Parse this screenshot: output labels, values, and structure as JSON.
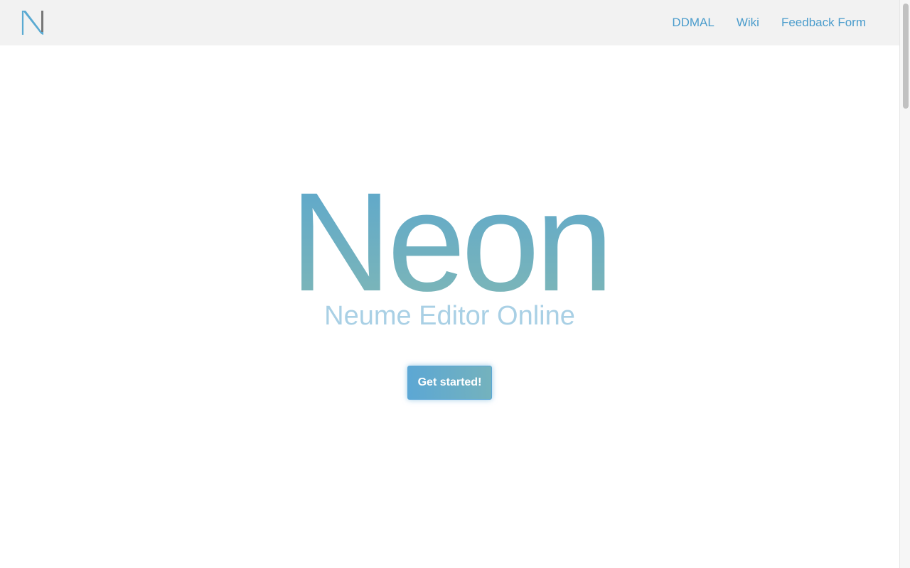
{
  "nav": {
    "logo_icon": "neon-n-logo-icon",
    "links": [
      {
        "label": "DDMAL"
      },
      {
        "label": "Wiki"
      },
      {
        "label": "Feedback Form"
      }
    ]
  },
  "hero": {
    "title": "Neon",
    "subtitle": "Neume Editor Online",
    "cta_label": "Get started!"
  },
  "colors": {
    "navbar_bg": "#f2f2f2",
    "link": "#4a9ccc",
    "title_gradient_start": "#5ca7cd",
    "title_gradient_end": "#7fb7b6",
    "subtitle": "#a9d0e5",
    "button_gradient_start": "#5ca7d4",
    "button_gradient_end": "#74b2bd"
  }
}
